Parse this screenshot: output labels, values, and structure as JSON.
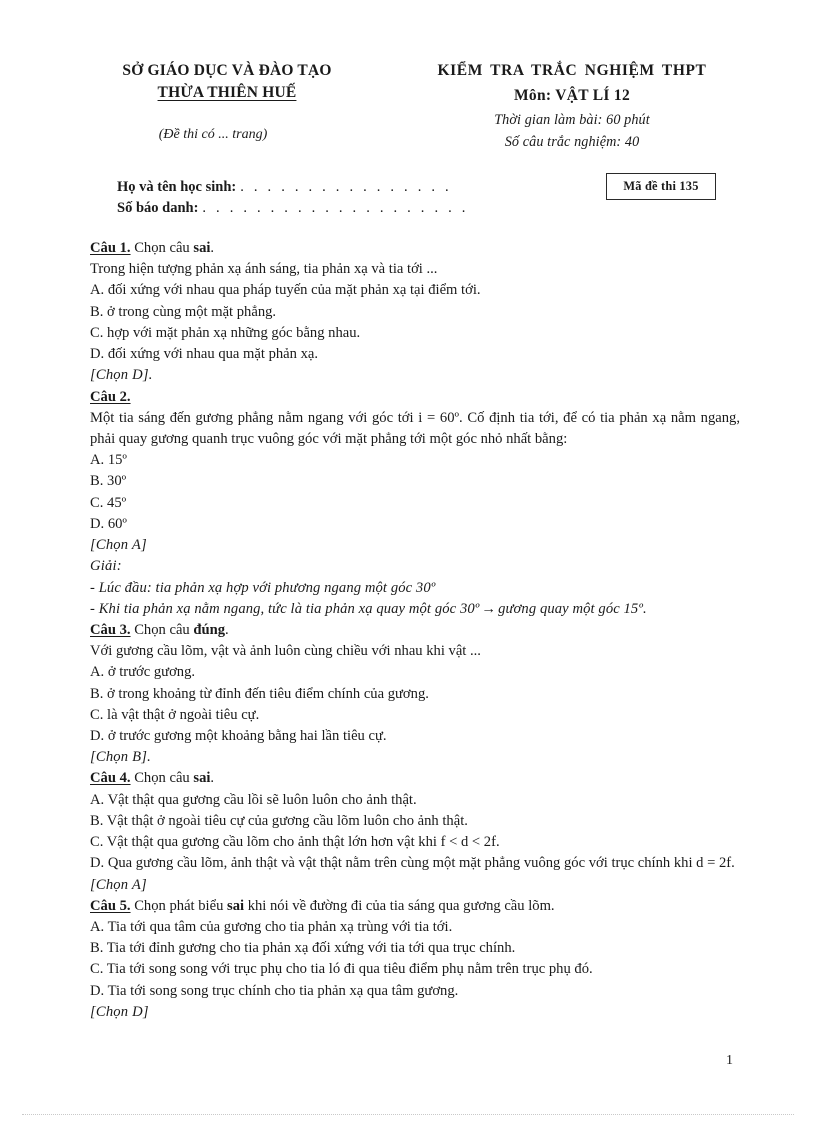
{
  "header": {
    "department_line1": "SỞ GIÁO DỤC VÀ ĐÀO TẠO",
    "department_line2": "THỪA THIÊN HUẾ",
    "pages_note": "(Đề thi có ... trang)",
    "exam_title": "KIỂM TRA TRẮC NGHIỆM THPT",
    "subject": "Môn: VẬT LÍ 12",
    "duration": "Thời gian làm bài: 60 phút",
    "question_count": "Số câu trắc nghiệm: 40"
  },
  "student_info": {
    "name_label": "Họ và tên học sinh:",
    "name_leader": ". . . . . . . . . . . . . . . .",
    "id_label": "Số báo danh:",
    "id_leader": ". . . . . . . . . . . . . . . . . . . ."
  },
  "exam_code": {
    "text": "Mã đề thi 135"
  },
  "questions": [
    {
      "label": "Câu 1.",
      "instruction_pre": "Chọn câu ",
      "instruction_bold": "sai",
      "instruction_post": ".",
      "stem": "Trong hiện tượng phản xạ ánh sáng, tia phản xạ và tia tới ...",
      "options": [
        "A. đối xứng với nhau qua pháp tuyến của mặt phản xạ tại điểm tới.",
        "B. ở trong cùng một mặt phẳng.",
        "C. hợp với mặt phản xạ những góc bằng nhau.",
        "D. đối xứng với nhau qua mặt phản xạ."
      ],
      "answer": "[Chọn D]."
    },
    {
      "label": "Câu 2.",
      "instruction_pre": "",
      "instruction_bold": "",
      "instruction_post": "",
      "stem": "Một tia sáng đến gương phẳng nằm ngang với góc tới i = 60º. Cố định tia tới, để có tia phản xạ nằm ngang, phải quay gương quanh trục vuông góc với mặt phẳng tới một góc nhỏ nhất bằng:",
      "options": [
        "A. 15º",
        "B. 30º",
        "C. 45º",
        "D. 60º"
      ],
      "answer": "[Chọn A]",
      "solution_head": "Giải:",
      "solution_lines": [
        "- Lúc đầu: tia phản xạ hợp với phương ngang một góc 30º",
        "- Khi tia phản xạ nằm ngang, tức là tia phản xạ quay một góc 30º"
      ],
      "solution_tail": "gương quay một góc 15º.",
      "arrow": "→"
    },
    {
      "label": "Câu 3.",
      "instruction_pre": "Chọn câu ",
      "instruction_bold": "đúng",
      "instruction_post": ".",
      "stem": "Với gương cầu lõm, vật và ảnh luôn cùng chiều với nhau khi vật ...",
      "options": [
        "A. ở trước gương.",
        "B. ở trong khoảng từ đỉnh đến tiêu điểm chính của gương.",
        "C. là vật thật ở ngoài tiêu cự.",
        "D. ở trước gương một khoảng bằng hai lần tiêu cự."
      ],
      "answer": "[Chọn B]."
    },
    {
      "label": "Câu 4.",
      "instruction_pre": "Chọn câu ",
      "instruction_bold": "sai",
      "instruction_post": ".",
      "stem": "",
      "options": [
        "A. Vật thật qua gương cầu lồi sẽ luôn luôn cho ảnh thật.",
        "B. Vật thật ở ngoài tiêu cự của gương cầu lõm luôn cho ảnh thật.",
        "C. Vật thật qua gương cầu lõm cho ảnh thật lớn hơn vật khi f < d < 2f.",
        "D. Qua gương cầu lõm, ảnh thật và vật thật nằm trên cùng một mặt phẳng vuông góc với trục chính khi d = 2f."
      ],
      "answer": "[Chọn A]"
    },
    {
      "label": "Câu 5.",
      "instruction_pre": "Chọn phát biểu ",
      "instruction_bold": "sai",
      "instruction_post": " khi nói về đường đi của tia sáng qua gương cầu lõm.",
      "stem": "",
      "options": [
        "A. Tia tới qua tâm của gương cho tia phản xạ trùng với tia tới.",
        "B. Tia tới đỉnh gương cho tia phản xạ đối xứng với tia tới qua trục chính.",
        "C. Tia tới song song với trục phụ cho tia ló đi qua tiêu điểm phụ nằm trên trục phụ đó.",
        "D. Tia tới song song trục chính cho tia phản xạ qua tâm gương."
      ],
      "answer": "[Chọn D]"
    }
  ],
  "footer": {
    "page_number": "1"
  }
}
